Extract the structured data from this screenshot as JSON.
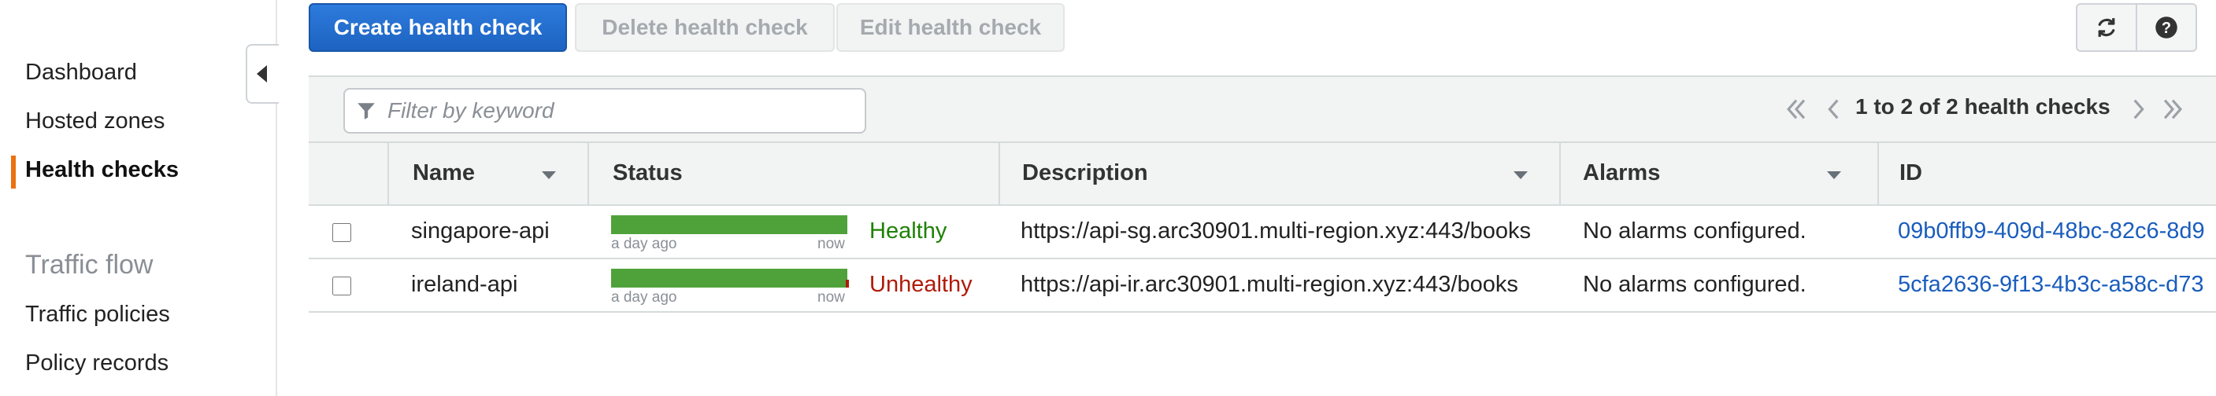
{
  "sidebar": {
    "items": [
      {
        "label": "Dashboard"
      },
      {
        "label": "Hosted zones"
      },
      {
        "label": "Health checks"
      }
    ],
    "section_title": "Traffic flow",
    "section_items": [
      {
        "label": "Traffic policies"
      },
      {
        "label": "Policy records"
      }
    ],
    "active_color": "#ec7211"
  },
  "toolbar": {
    "create_label": "Create health check",
    "delete_label": "Delete health check",
    "edit_label": "Edit health check",
    "refresh_icon": "refresh-icon",
    "help_icon": "help-icon"
  },
  "filter": {
    "placeholder": "Filter by keyword",
    "value": ""
  },
  "pagination": {
    "text": "1 to 2 of 2 health checks"
  },
  "table": {
    "columns": [
      "Name",
      "Status",
      "Description",
      "Alarms",
      "ID"
    ],
    "rows": [
      {
        "name": "singapore-api",
        "status": "Healthy",
        "status_color": "#1d8102",
        "status_history_start": "a day ago",
        "status_history_end": "now",
        "description": "https://api-sg.arc30901.multi-region.xyz:443/books",
        "alarms": "No alarms configured.",
        "id": "09b0ffb9-409d-48bc-82c6-8d9"
      },
      {
        "name": "ireland-api",
        "status": "Unhealthy",
        "status_color": "#b01a0a",
        "status_history_start": "a day ago",
        "status_history_end": "now",
        "description": "https://api-ir.arc30901.multi-region.xyz:443/books",
        "alarms": "No alarms configured.",
        "id": "5cfa2636-9f13-4b3c-a58c-d73"
      }
    ]
  }
}
